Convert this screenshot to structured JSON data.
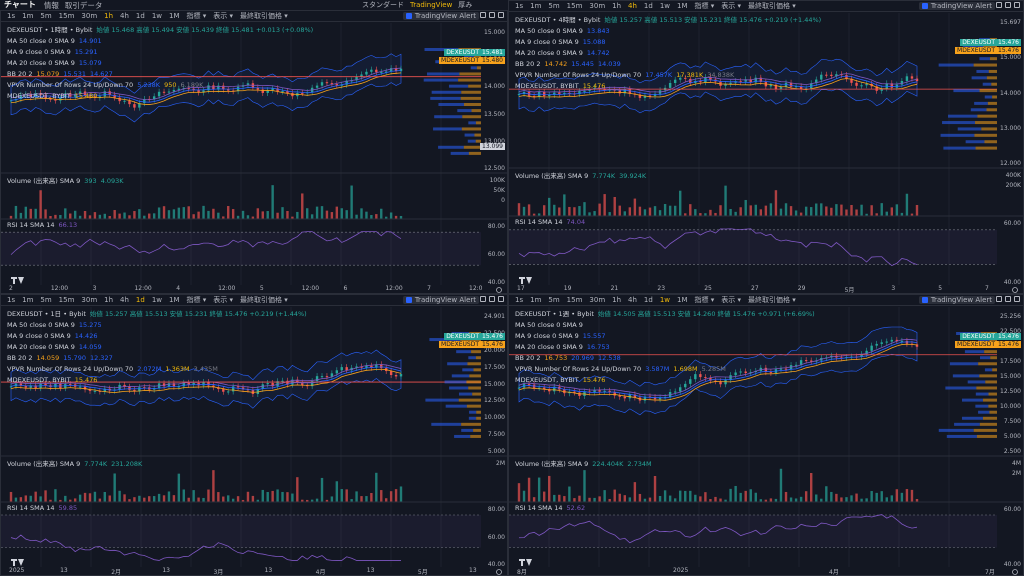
{
  "app": {
    "brand": "チャート",
    "tabs": [
      "情報",
      "取引データ"
    ],
    "top_right": [
      "スタンダード",
      "TradingView",
      "厚み"
    ]
  },
  "panes": [
    {
      "id": "p1",
      "toolbar": [
        "1s",
        "1m",
        "5m",
        "15m",
        "30m",
        "1h",
        "4h",
        "1d",
        "1w",
        "1M",
        "指標 ▾",
        "表示 ▾",
        "最終取引価格 ▾"
      ],
      "active_interval": "1h",
      "alert_label": "TradingView Alert",
      "title": "DEXEUSDT • 1時間 • Bybit",
      "ohlc": "始値 15.468 高値 15.494 安値 15.439 終値 15.481 +0.013 (+0.08%)",
      "ma50": {
        "label": "MA 50 close 0 SMA 9",
        "value": "14.901"
      },
      "ma9": {
        "label": "MA 9 close 0 SMA 9",
        "value": "15.291"
      },
      "ma20": {
        "label": "MA 20 close 0 SMA 9",
        "value": "15.079"
      },
      "bb": {
        "label": "BB 20 2",
        "v1": "15.079",
        "v2": "15.531",
        "v3": "14.627"
      },
      "vpvr": {
        "label": "VPVR Number Of Rows 24 Up/Down 70",
        "v1": "5.238K",
        "v2": "950",
        "v3": "6.189K"
      },
      "mdexe": {
        "label": "MDEXEUSDT, BYBIT",
        "value": "15.480"
      },
      "price_ticks": [
        "15.000",
        "14.500",
        "14.000",
        "13.500",
        "13.000",
        "12.500"
      ],
      "tags": [
        "DEXEUSDT",
        "MDEXEUSDT",
        "15.481",
        "15.480",
        "13.099"
      ],
      "volume": {
        "label": "Volume (出来高) SMA 9",
        "v1": "393",
        "v2": "4.093K",
        "ticks": [
          "100K",
          "50K",
          "0"
        ]
      },
      "rsi": {
        "label": "RSI 14 SMA 14",
        "value": "66.13",
        "ticks": [
          "80.00",
          "60.00",
          "40.00"
        ]
      },
      "time_ticks": [
        "2",
        "12:00",
        "3",
        "12:00",
        "4",
        "12:00",
        "5",
        "12:00",
        "6",
        "12:00",
        "7",
        "12:0"
      ]
    },
    {
      "id": "p2",
      "toolbar": [
        "1s",
        "1m",
        "5m",
        "15m",
        "30m",
        "1h",
        "4h",
        "1d",
        "1w",
        "1M",
        "指標 ▾",
        "表示 ▾",
        "最終取引価格 ▾"
      ],
      "active_interval": "4h",
      "alert_label": "TradingView Alert",
      "title": "DEXEUSDT • 4時間 • Bybit",
      "ohlc": "始値 15.257 高値 15.513 安値 15.231 終値 15.476 +0.219 (+1.44%)",
      "ma50": {
        "label": "MA 50 close 0 SMA 9",
        "value": "13.843"
      },
      "ma9": {
        "label": "MA 9 close 0 SMA 9",
        "value": "15.088"
      },
      "ma20": {
        "label": "MA 20 close 0 SMA 9",
        "value": "14.742"
      },
      "bb": {
        "label": "BB 20 2",
        "v1": "14.742",
        "v2": "15.445",
        "v3": "14.039"
      },
      "vpvr": {
        "label": "VPVR Number Of Rows 24 Up/Down 70",
        "v1": "17.457K",
        "v2": "17.381K",
        "v3": "34.838K"
      },
      "mdexe": {
        "label": "MDEXEUSDT, BYBIT",
        "value": "15.476"
      },
      "price_ticks": [
        "15.697",
        "15.000",
        "14.000",
        "13.000",
        "12.000"
      ],
      "tags": [
        "DEXEUSDT",
        "MDEXEUSDT",
        "15.476",
        "15.476"
      ],
      "volume": {
        "label": "Volume (出来高) SMA 9",
        "v1": "7.774K",
        "v2": "39.924K",
        "ticks": [
          "400K",
          "200K"
        ]
      },
      "rsi": {
        "label": "RSI 14 SMA 14",
        "value": "74.04",
        "ticks": [
          "60.00",
          "40.00"
        ]
      },
      "time_ticks": [
        "17",
        "19",
        "21",
        "23",
        "25",
        "27",
        "29",
        "5月",
        "3",
        "5",
        "7"
      ]
    },
    {
      "id": "p3",
      "toolbar": [
        "1s",
        "1m",
        "5m",
        "15m",
        "30m",
        "1h",
        "4h",
        "1d",
        "1w",
        "1M",
        "指標 ▾",
        "表示 ▾",
        "最終取引価格 ▾"
      ],
      "active_interval": "1d",
      "alert_label": "TradingView Alert",
      "title": "DEXEUSDT • 1日 • Bybit",
      "ohlc": "始値 15.257 高値 15.513 安値 15.231 終値 15.476 +0.219 (+1.44%)",
      "ma50": {
        "label": "MA 50 close 0 SMA 9",
        "value": "15.275"
      },
      "ma9": {
        "label": "MA 9 close 0 SMA 9",
        "value": "14.426"
      },
      "ma20": {
        "label": "MA 20 close 0 SMA 9",
        "value": "14.059"
      },
      "bb": {
        "label": "BB 20 2",
        "v1": "14.059",
        "v2": "15.790",
        "v3": "12.327"
      },
      "vpvr": {
        "label": "VPVR Number Of Rows 24 Up/Down 70",
        "v1": "2.072M",
        "v2": "1.363M",
        "v3": "3.435M"
      },
      "mdexe": {
        "label": "MDEXEUSDT, BYBIT",
        "value": "15.476"
      },
      "price_ticks": [
        "24.901",
        "22.500",
        "20.000",
        "17.500",
        "15.000",
        "12.500",
        "10.000",
        "7.500",
        "5.000"
      ],
      "tags": [
        "DEXEUSDT",
        "MDEXEUSDT",
        "15.476",
        "15.476"
      ],
      "volume": {
        "label": "Volume (出来高) SMA 9",
        "v1": "7.774K",
        "v2": "231.208K",
        "ticks": [
          "2M"
        ]
      },
      "rsi": {
        "label": "RSI 14 SMA 14",
        "value": "59.85",
        "ticks": [
          "80.00",
          "60.00",
          "40.00"
        ]
      },
      "time_ticks": [
        "2025",
        "13",
        "2月",
        "13",
        "3月",
        "13",
        "4月",
        "13",
        "5月",
        "13"
      ]
    },
    {
      "id": "p4",
      "toolbar": [
        "1s",
        "1m",
        "5m",
        "15m",
        "30m",
        "1h",
        "4h",
        "1d",
        "1w",
        "1M",
        "指標 ▾",
        "表示 ▾",
        "最終取引価格 ▾"
      ],
      "active_interval": "1w",
      "alert_label": "TradingView Alert",
      "title": "DEXEUSDT • 1週 • Bybit",
      "ohlc": "始値 14.505 高値 15.513 安値 14.260 終値 15.476 +0.971 (+6.69%)",
      "ma50": {
        "label": "MA 50 close 0 SMA 9",
        "value": ""
      },
      "ma9": {
        "label": "MA 9 close 0 SMA 9",
        "value": "15.557"
      },
      "ma20": {
        "label": "MA 20 close 0 SMA 9",
        "value": "16.753"
      },
      "bb": {
        "label": "BB 20 2",
        "v1": "16.753",
        "v2": "20.969",
        "v3": "12.538"
      },
      "vpvr": {
        "label": "VPVR Number Of Rows 24 Up/Down 70",
        "v1": "3.587M",
        "v2": "1.698M",
        "v3": "5.285M"
      },
      "mdexe": {
        "label": "MDEXEUSDT, BYBIT",
        "value": "15.476"
      },
      "price_ticks": [
        "25.256",
        "22.500",
        "20.000",
        "17.500",
        "15.000",
        "12.500",
        "10.000",
        "7.500",
        "5.000",
        "2.500"
      ],
      "tags": [
        "DEXEUSDT",
        "MDEXEUSDT",
        "15.476",
        "15.476"
      ],
      "volume": {
        "label": "Volume (出来高) SMA 9",
        "v1": "224.404K",
        "v2": "2.734M",
        "ticks": [
          "4M",
          "2M"
        ]
      },
      "rsi": {
        "label": "RSI 14 SMA 14",
        "value": "52.62",
        "ticks": [
          "60.00",
          "40.00"
        ]
      },
      "time_ticks": [
        "8月",
        "2025",
        "4月",
        "7月"
      ]
    }
  ]
}
